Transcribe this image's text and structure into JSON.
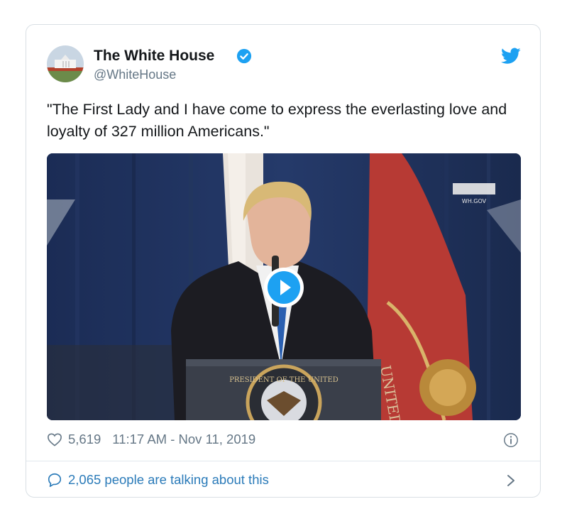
{
  "tweet": {
    "author_name": "The White House",
    "author_handle": "@WhiteHouse",
    "text": "\"The First Lady and I have come to express the everlasting love and loyalty of 327 million Americans.\"",
    "likes": "5,619",
    "timestamp": "11:17 AM - Nov 11, 2019",
    "talking": "2,065 people are talking about this"
  },
  "media": {
    "watermark": "WH.GOV",
    "seal_text": "PRESIDENT OF THE UNITED",
    "flag_text": "UNITED STA"
  },
  "icons": {
    "verified": "verified-badge-icon",
    "bird": "twitter-bird-icon",
    "heart": "heart-icon",
    "info": "info-icon",
    "reply": "speech-bubble-icon",
    "chevron": "chevron-right-icon",
    "play": "play-icon"
  },
  "colors": {
    "accent": "#1da1f2",
    "link": "#2b7bb9",
    "muted": "#657786",
    "text": "#14171a",
    "border": "#d9dfe4"
  }
}
